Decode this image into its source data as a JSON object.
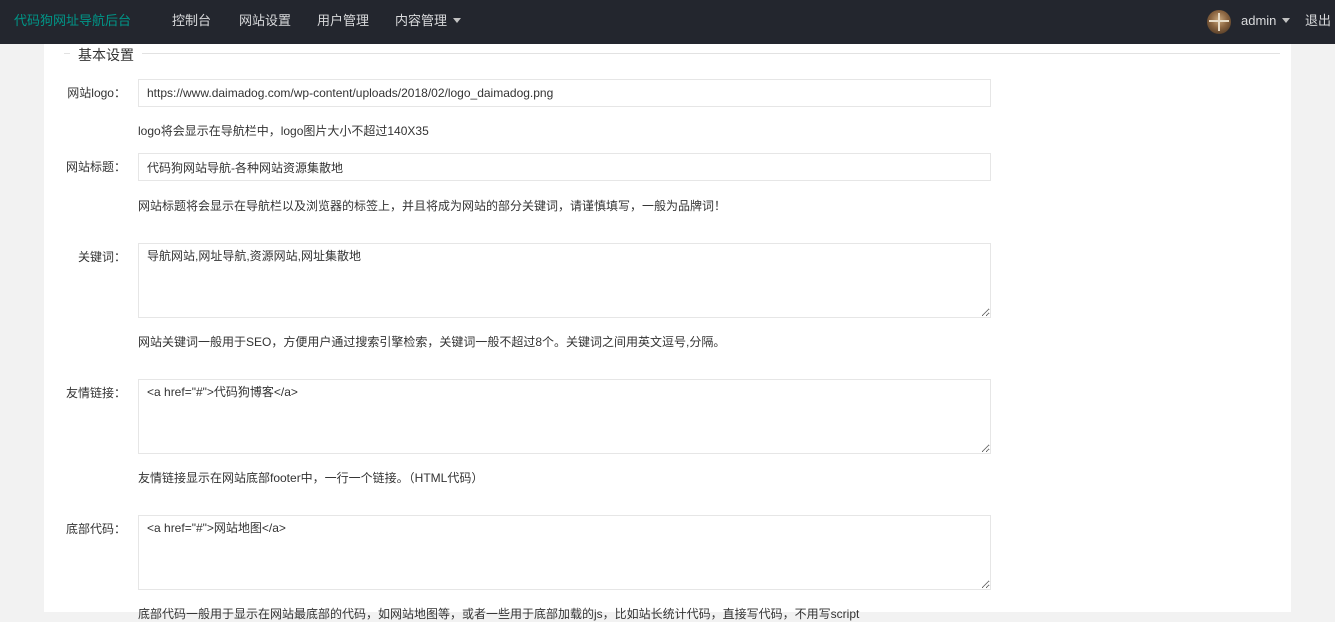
{
  "header": {
    "brand": "代码狗网址导航后台",
    "nav": [
      {
        "label": "控制台"
      },
      {
        "label": "网站设置"
      },
      {
        "label": "用户管理"
      },
      {
        "label": "内容管理"
      }
    ],
    "user": "admin",
    "logout": "退出"
  },
  "section": {
    "title": "基本设置"
  },
  "form": {
    "logo": {
      "label": "网站logo：",
      "value": "https://www.daimadog.com/wp-content/uploads/2018/02/logo_daimadog.png",
      "help": "logo将会显示在导航栏中，logo图片大小不超过140X35"
    },
    "title": {
      "label": "网站标题：",
      "value": "代码狗网站导航-各种网站资源集散地",
      "help": "网站标题将会显示在导航栏以及浏览器的标签上，并且将成为网站的部分关键词，请谨慎填写，一般为品牌词！"
    },
    "keywords": {
      "label": "关键词：",
      "value": "导航网站,网址导航,资源网站,网址集散地",
      "help": "网站关键词一般用于SEO，方便用户通过搜索引擎检索，关键词一般不超过8个。关键词之间用英文逗号,分隔。"
    },
    "links": {
      "label": "友情链接：",
      "value": "<a href=\"#\">代码狗博客</a>",
      "help": "友情链接显示在网站底部footer中，一行一个链接。（HTML代码）"
    },
    "footer": {
      "label": "底部代码：",
      "value": "<a href=\"#\">网站地图</a>",
      "help": "底部代码一般用于显示在网站最底部的代码，如网站地图等，或者一些用于底部加载的js，比如站长统计代码，直接写代码，不用写script"
    }
  },
  "colors": {
    "topbar": "#23262e",
    "brand": "#009688",
    "nav_text": "#d9dadc",
    "panel": "#ffffff",
    "page_bg": "#f2f2f2",
    "border": "#e6e6e6"
  }
}
